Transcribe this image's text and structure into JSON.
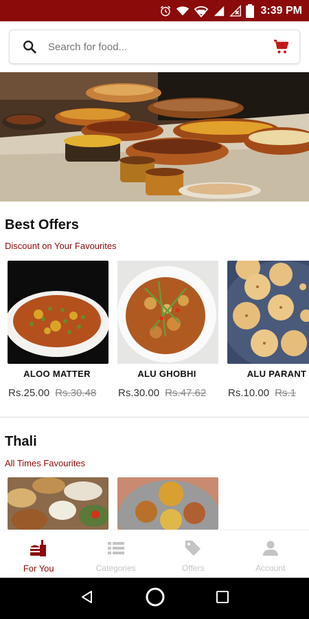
{
  "status_bar": {
    "time": "3:39 PM",
    "icons": [
      "alarm-icon",
      "wifi-icon",
      "volte-icon",
      "signal-icon",
      "signal-noservice-icon",
      "battery-icon"
    ],
    "background": "#8b0a0a"
  },
  "search": {
    "placeholder": "Search for food...",
    "value": ""
  },
  "banner": {
    "image": "food-buffet-photo"
  },
  "best_offers": {
    "title": "Best Offers",
    "subtitle": "Discount on Your Favourites",
    "items": [
      {
        "name": "ALOO MATTER",
        "price": "Rs.25.00",
        "old_price": "Rs.30.48",
        "image": "aloo-matter-photo"
      },
      {
        "name": "ALU GHOBHI",
        "price": "Rs.30.00",
        "old_price": "Rs.47.62",
        "image": "alu-ghobhi-photo"
      },
      {
        "name": "ALU PARANT",
        "price": "Rs.10.00",
        "old_price": "Rs.1",
        "image": "alu-paratha-photo"
      }
    ]
  },
  "thali": {
    "title": "Thali",
    "subtitle": "All Times Favourites",
    "items": [
      {
        "image": "thali-platter-photo-1"
      },
      {
        "image": "thali-platter-photo-2"
      }
    ]
  },
  "bottom_nav": {
    "items": [
      {
        "label": "For You",
        "icon": "fast-food-icon",
        "active": true
      },
      {
        "label": "Categories",
        "icon": "list-icon",
        "active": false
      },
      {
        "label": "Offers",
        "icon": "tag-icon",
        "active": false
      },
      {
        "label": "Account",
        "icon": "person-icon",
        "active": false
      }
    ]
  },
  "colors": {
    "accent": "#8b0a0a",
    "inactive": "#c4c4c4"
  }
}
